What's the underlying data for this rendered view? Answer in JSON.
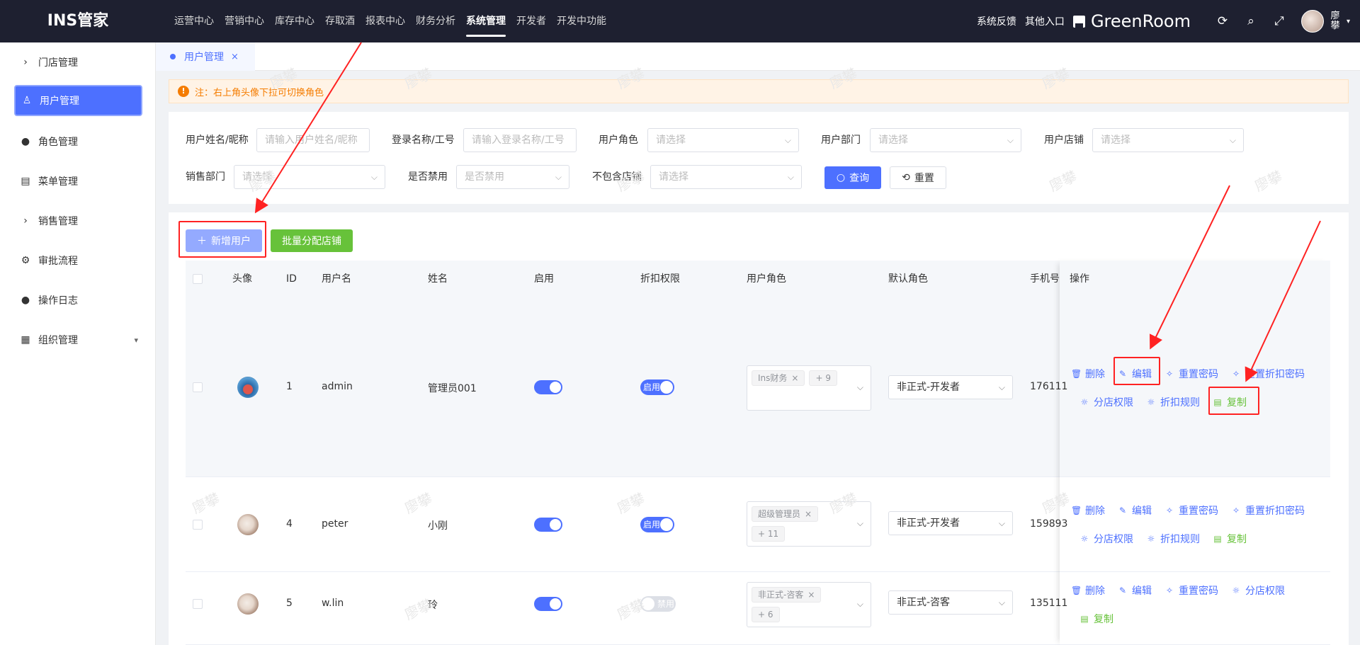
{
  "app": {
    "logo": "INS管家"
  },
  "topnav": [
    "运营中心",
    "营销中心",
    "库存中心",
    "存取酒",
    "报表中心",
    "财务分析",
    "系统管理",
    "开发者",
    "开发中功能"
  ],
  "topnav_active": "系统管理",
  "topright": {
    "feedback": "系统反馈",
    "other": "其他入口",
    "store": "GreenRoom",
    "user": "廖\n攀"
  },
  "sidebar": [
    {
      "label": "门店管理",
      "icon": "chevron-right-icon"
    },
    {
      "label": "用户管理",
      "icon": "user-icon",
      "active": true
    },
    {
      "label": "角色管理",
      "icon": "person-icon"
    },
    {
      "label": "菜单管理",
      "icon": "document-icon"
    },
    {
      "label": "销售管理",
      "icon": "chevron-right-icon"
    },
    {
      "label": "审批流程",
      "icon": "gear-icon"
    },
    {
      "label": "操作日志",
      "icon": "person-icon"
    },
    {
      "label": "组织管理",
      "icon": "building-icon"
    }
  ],
  "tab": {
    "label": "用户管理",
    "close": "×"
  },
  "notice": {
    "icon": "!",
    "text": "注：右上角头像下拉可切换角色"
  },
  "filters": {
    "user_name": {
      "label": "用户姓名/昵称",
      "placeholder": "请输入用户姓名/昵称"
    },
    "login_name": {
      "label": "登录名称/工号",
      "placeholder": "请输入登录名称/工号"
    },
    "user_role": {
      "label": "用户角色",
      "placeholder": "请选择"
    },
    "user_dept": {
      "label": "用户部门",
      "placeholder": "请选择"
    },
    "user_store": {
      "label": "用户店铺",
      "placeholder": "请选择"
    },
    "sales_dept": {
      "label": "销售部门",
      "placeholder": "请选择"
    },
    "disabled": {
      "label": "是否禁用",
      "placeholder": "是否禁用"
    },
    "exclude_store": {
      "label": "不包含店铺",
      "placeholder": "请选择"
    },
    "search_btn": "查询",
    "reset_btn": "重置"
  },
  "actions": {
    "add_user": "新增用户",
    "batch_assign": "批量分配店铺"
  },
  "table": {
    "headers": [
      "头像",
      "ID",
      "用户名",
      "姓名",
      "启用",
      "折扣权限",
      "用户角色",
      "默认角色",
      "手机号",
      "操作"
    ],
    "rows": [
      {
        "id": "1",
        "username": "admin",
        "name": "管理员001",
        "enabled": true,
        "discount": "启用",
        "discount_on": true,
        "role_tag": "Ins财务",
        "role_more": "+ 9",
        "default_role": "非正式-开发者",
        "phone": "176111",
        "avatar": "blue"
      },
      {
        "id": "4",
        "username": "peter",
        "name": "小刚",
        "enabled": true,
        "discount": "启用",
        "discount_on": true,
        "role_tag": "超级管理员",
        "role_more": "+ 11",
        "default_role": "非正式-开发者",
        "phone": "159893",
        "avatar": "cat"
      },
      {
        "id": "5",
        "username": "w.lin",
        "name": "玲",
        "enabled": true,
        "discount": "禁用",
        "discount_on": false,
        "role_tag": "非正式-咨客",
        "role_more": "+ 6",
        "default_role": "非正式-咨客",
        "phone": "135111",
        "avatar": "cat"
      }
    ],
    "ops": {
      "delete": "删除",
      "edit": "编辑",
      "reset_pwd": "重置密码",
      "reset_discount_pwd": "重置折扣密码",
      "store_perm": "分店权限",
      "discount_rule": "折扣规则",
      "copy": "复制"
    }
  },
  "watermark": "廖攀",
  "colors": {
    "primary": "#4d70ff",
    "success": "#67c23a",
    "warning": "#f57c00",
    "annotation": "#ff2222",
    "header_bg": "#1e2030"
  }
}
